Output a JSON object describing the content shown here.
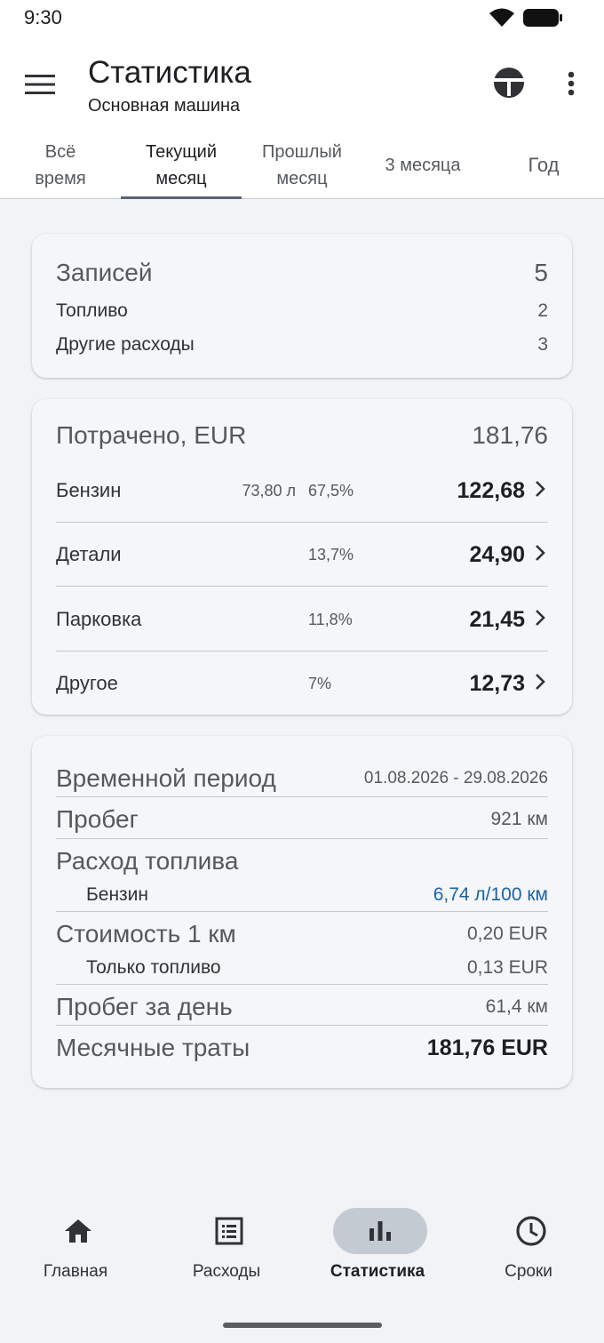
{
  "status": {
    "time": "9:30"
  },
  "header": {
    "title": "Статистика",
    "subtitle": "Основная машина"
  },
  "tabs": [
    {
      "label": "Всё\nвремя"
    },
    {
      "label": "Текущий\nмесяц",
      "active": true
    },
    {
      "label": "Прошлый\nмесяц"
    },
    {
      "label": "3 месяца"
    },
    {
      "label": "Год"
    }
  ],
  "records": {
    "title": "Записей",
    "total": "5",
    "fuel_label": "Топливо",
    "fuel_value": "2",
    "other_label": "Другие расходы",
    "other_value": "3"
  },
  "spent": {
    "title": "Потрачено, EUR",
    "total": "181,76",
    "items": [
      {
        "name": "Бензин",
        "volume": "73,80 л",
        "percent": "67,5%",
        "amount": "122,68"
      },
      {
        "name": "Детали",
        "volume": "",
        "percent": "13,7%",
        "amount": "24,90"
      },
      {
        "name": "Парковка",
        "volume": "",
        "percent": "11,8%",
        "amount": "21,45"
      },
      {
        "name": "Другое",
        "volume": "",
        "percent": "7%",
        "amount": "12,73"
      }
    ]
  },
  "period": {
    "period_label": "Временной период",
    "period_value": "01.08.2026 - 29.08.2026",
    "mileage_label": "Пробег",
    "mileage_value": "921 км",
    "consumption_label": "Расход топлива",
    "petrol_label": "Бензин",
    "petrol_value": "6,74 л/100 км",
    "cost_km_label": "Стоимость 1 км",
    "cost_km_value": "0,20 EUR",
    "fuel_only_label": "Только топливо",
    "fuel_only_value": "0,13 EUR",
    "daily_label": "Пробег за день",
    "daily_value": "61,4 км",
    "monthly_label": "Месячные траты",
    "monthly_value": "181,76 EUR"
  },
  "nav": [
    {
      "label": "Главная",
      "icon": "home-icon"
    },
    {
      "label": "Расходы",
      "icon": "list-icon"
    },
    {
      "label": "Статистика",
      "icon": "chart-icon",
      "active": true
    },
    {
      "label": "Сроки",
      "icon": "clock-icon"
    }
  ],
  "colors": {
    "accent_blue": "#1a63a8",
    "active_pill": "#c3cad2",
    "background": "#f2f3f5"
  }
}
